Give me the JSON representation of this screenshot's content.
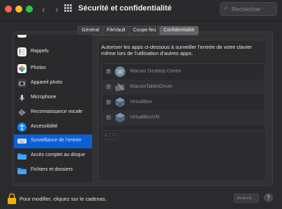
{
  "window": {
    "title": "Sécurité et confidentialité",
    "search_placeholder": "Rechercher",
    "nav_back": "‹",
    "nav_forward": "›"
  },
  "tabs": [
    {
      "label": "Général",
      "active": false
    },
    {
      "label": "FileVault",
      "active": false
    },
    {
      "label": "Coupe-feu",
      "active": false
    },
    {
      "label": "Confidentialité",
      "active": true
    }
  ],
  "sidebar": {
    "items": [
      {
        "label": "Rappels",
        "icon": "reminders-icon"
      },
      {
        "label": "Photos",
        "icon": "photos-icon"
      },
      {
        "label": "Appareil photo",
        "icon": "camera-icon"
      },
      {
        "label": "Microphone",
        "icon": "microphone-icon"
      },
      {
        "label": "Reconnaissance vocale",
        "icon": "speech-recognition-icon"
      },
      {
        "label": "Accessibilité",
        "icon": "accessibility-icon"
      },
      {
        "label": "Surveillance de l’entrée",
        "icon": "keyboard-icon",
        "selected": true
      },
      {
        "label": "Accès complet au disque",
        "icon": "folder-icon"
      },
      {
        "label": "Fichiers et dossiers",
        "icon": "folder-icon"
      }
    ]
  },
  "content": {
    "description": "Autoriser les apps ci-dessous à surveiller l’entrée de votre clavier même lors de l’utilisation d’autres apps.",
    "apps": [
      {
        "name": "Wacom Desktop Center",
        "checked": true,
        "icon": "wacom-desktop-center-icon"
      },
      {
        "name": "WacomTabletDriver",
        "checked": true,
        "icon": "wacom-tablet-driver-icon"
      },
      {
        "name": "VirtualBox",
        "checked": true,
        "icon": "virtualbox-icon"
      },
      {
        "name": "VirtualBoxVM",
        "checked": true,
        "icon": "virtualbox-vm-icon"
      }
    ],
    "add_label": "+",
    "remove_label": "−"
  },
  "footer": {
    "lock_text": "Pour modifier, cliquez sur le cadenas.",
    "advanced_label": "Avancé…",
    "help_label": "?"
  },
  "colors": {
    "background": "#2b2b2d",
    "selection": "#0b5fd7",
    "close": "#fe5f57",
    "minimize": "#febc2e",
    "maximize": "#28c840",
    "lock": "#f2b300"
  }
}
